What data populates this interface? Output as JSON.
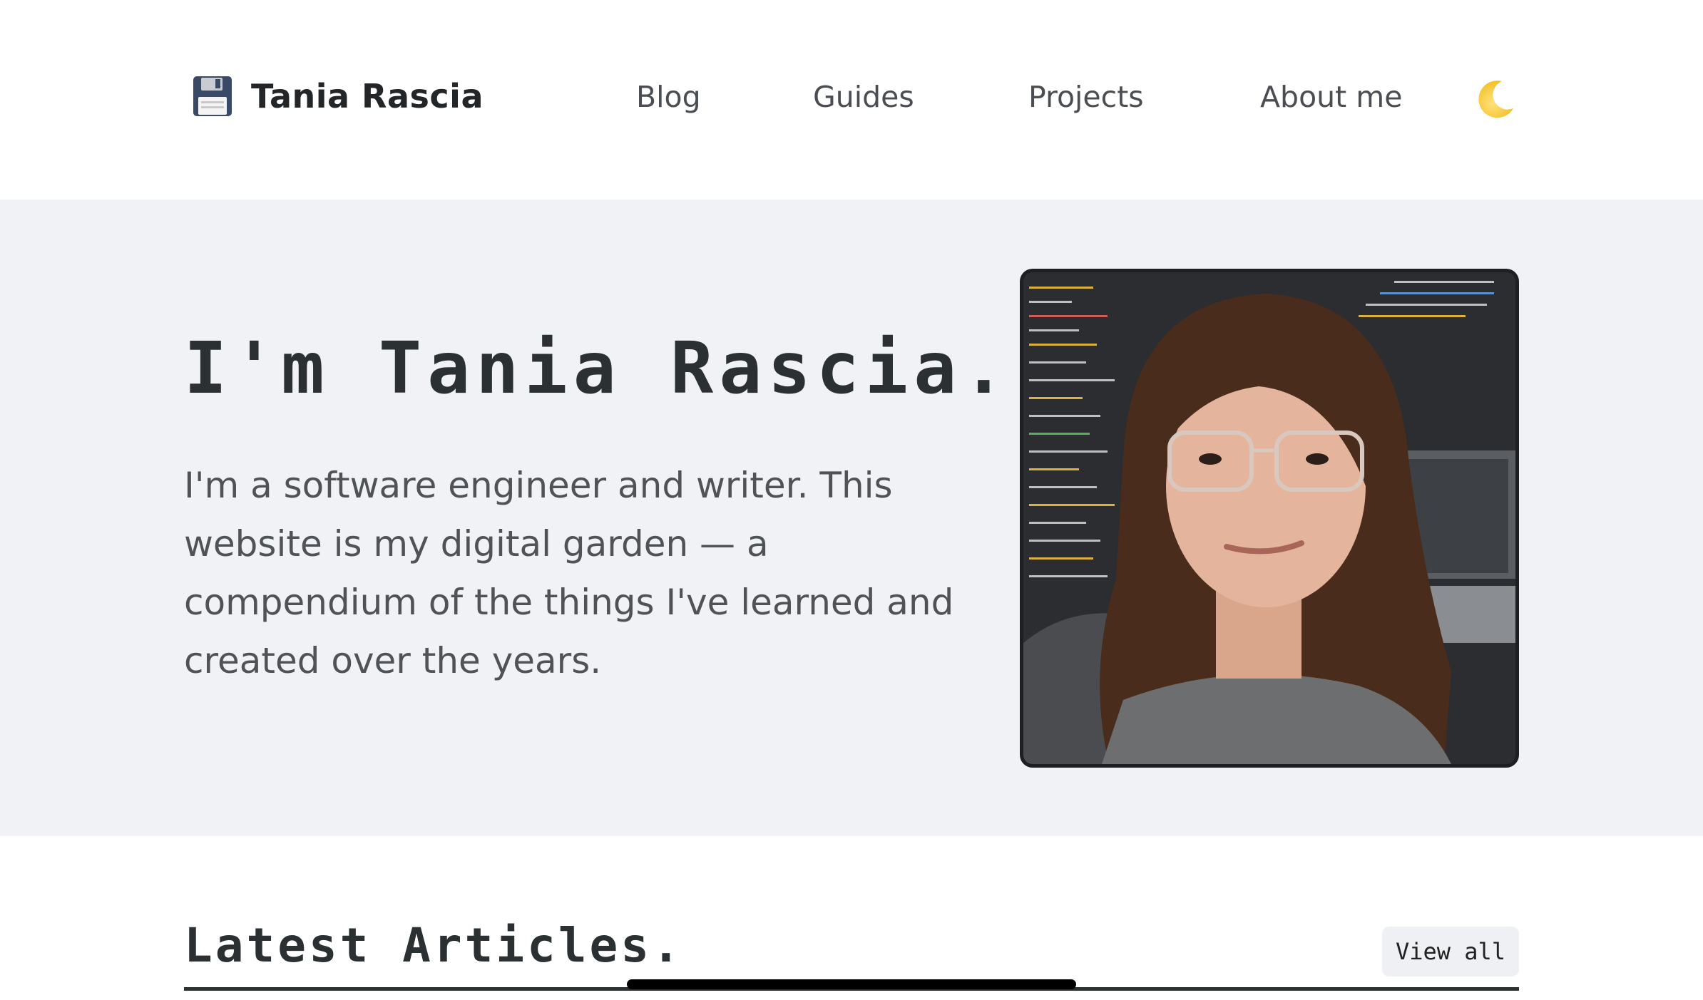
{
  "site": {
    "name": "Tania Rascia",
    "logo_icon": "floppy-disk-icon"
  },
  "nav": {
    "items": [
      {
        "label": "Blog"
      },
      {
        "label": "Guides"
      },
      {
        "label": "Projects"
      },
      {
        "label": "About me"
      }
    ],
    "theme_toggle_icon": "crescent-moon-icon"
  },
  "hero": {
    "title": "I'm Tania Rascia.",
    "description": "I'm a software engineer and writer. This website is my digital garden — a compendium of the things I've learned and created over the years.",
    "photo_alt": "Tania Rascia"
  },
  "articles": {
    "title": "Latest Articles.",
    "view_all_label": "View all"
  },
  "colors": {
    "hero_background": "#f1f2f5",
    "text_dark": "#2b3033",
    "text_muted": "#4f5357"
  }
}
